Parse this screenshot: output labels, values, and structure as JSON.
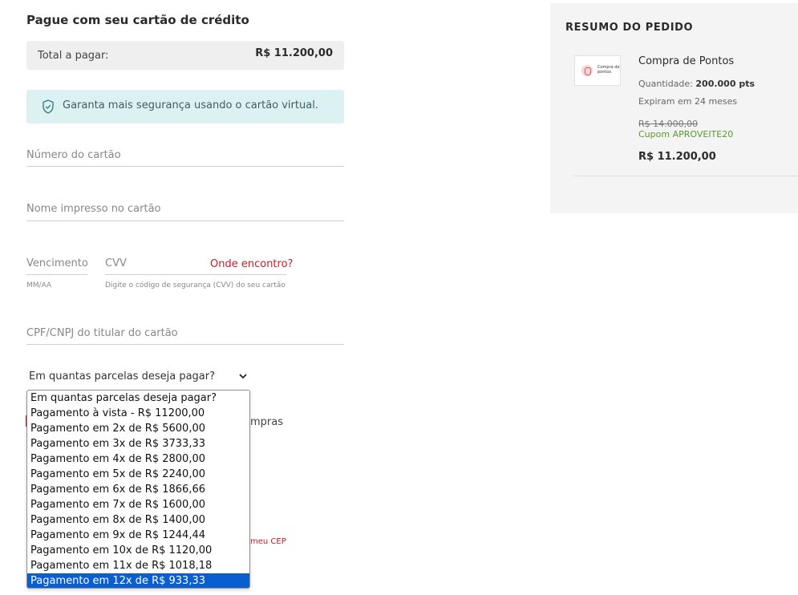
{
  "payment": {
    "title": "Pague com seu cartão de crédito",
    "total_label": "Total a pagar:",
    "total_value": "R$ 11.200,00",
    "virtual_card_notice": "Garanta mais segurança usando o cartão virtual.",
    "card_number_placeholder": "Número do cartão",
    "card_name_placeholder": "Nome impresso no cartão",
    "expiry_placeholder": "Vencimento",
    "expiry_helper": "MM/AA",
    "cvv_placeholder": "CVV",
    "cvv_link": "Onde encontro?",
    "cvv_helper": "Digite o código de segurança (CVV) do seu cartão",
    "cpf_placeholder": "CPF/CNPJ do titular do cartão",
    "installments_select": "Em quantas parcelas deseja pagar?",
    "installment_options": [
      "Em quantas parcelas deseja pagar?",
      "Pagamento à vista - R$ 11200,00",
      "Pagamento em 2x de R$ 5600,00",
      "Pagamento em 3x de R$ 3733,33",
      "Pagamento em 4x de R$ 2800,00",
      "Pagamento em 5x de R$ 2240,00",
      "Pagamento em 6x de R$ 1866,66",
      "Pagamento em 7x de R$ 1600,00",
      "Pagamento em 8x de R$ 1400,00",
      "Pagamento em 9x de R$ 1244,44",
      "Pagamento em 10x de R$ 1120,00",
      "Pagamento em 11x de R$ 1018,18",
      "Pagamento em 12x de R$ 933,33"
    ],
    "selected_option_index": 12,
    "behind_text_1": "mpras",
    "behind_text_2": "meu CEP"
  },
  "summary": {
    "title": "RESUMO DO PEDIDO",
    "thumb_text": "Compra de pontos",
    "product_name": "Compra de Pontos",
    "quantity_label": "Quantidade:",
    "quantity_value": "200.000 pts",
    "expire_text": "Expiram em 24 meses",
    "old_price": "R$ 14.000,00",
    "coupon": "Cupom APROVEITE20",
    "new_price": "R$ 11.200,00"
  },
  "colors": {
    "accent_red": "#c0202a",
    "notice_bg": "#dcf1f1",
    "selected_option": "#0a5fd0",
    "coupon_green": "#5a9a2c"
  }
}
